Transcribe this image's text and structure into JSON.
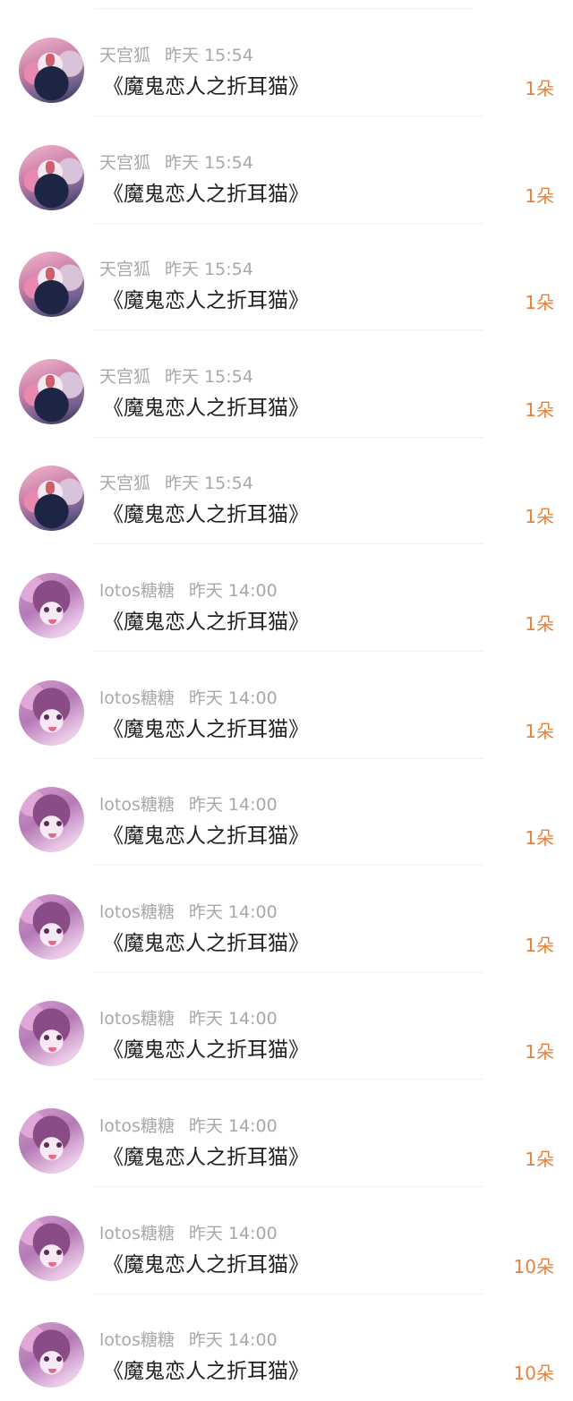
{
  "items": [
    {
      "user": "天宫狐",
      "time": "昨天 15:54",
      "title": "《魔鬼恋人之折耳猫》",
      "count": "1朵",
      "avatar": "fox-avatar"
    },
    {
      "user": "天宫狐",
      "time": "昨天 15:54",
      "title": "《魔鬼恋人之折耳猫》",
      "count": "1朵",
      "avatar": "fox-avatar"
    },
    {
      "user": "天宫狐",
      "time": "昨天 15:54",
      "title": "《魔鬼恋人之折耳猫》",
      "count": "1朵",
      "avatar": "fox-avatar"
    },
    {
      "user": "天宫狐",
      "time": "昨天 15:54",
      "title": "《魔鬼恋人之折耳猫》",
      "count": "1朵",
      "avatar": "fox-avatar"
    },
    {
      "user": "天宫狐",
      "time": "昨天 15:54",
      "title": "《魔鬼恋人之折耳猫》",
      "count": "1朵",
      "avatar": "fox-avatar"
    },
    {
      "user": "lotos糖糖",
      "time": "昨天 14:00",
      "title": "《魔鬼恋人之折耳猫》",
      "count": "1朵",
      "avatar": "girl-avatar"
    },
    {
      "user": "lotos糖糖",
      "time": "昨天 14:00",
      "title": "《魔鬼恋人之折耳猫》",
      "count": "1朵",
      "avatar": "girl-avatar"
    },
    {
      "user": "lotos糖糖",
      "time": "昨天 14:00",
      "title": "《魔鬼恋人之折耳猫》",
      "count": "1朵",
      "avatar": "girl-avatar"
    },
    {
      "user": "lotos糖糖",
      "time": "昨天 14:00",
      "title": "《魔鬼恋人之折耳猫》",
      "count": "1朵",
      "avatar": "girl-avatar"
    },
    {
      "user": "lotos糖糖",
      "time": "昨天 14:00",
      "title": "《魔鬼恋人之折耳猫》",
      "count": "1朵",
      "avatar": "girl-avatar"
    },
    {
      "user": "lotos糖糖",
      "time": "昨天 14:00",
      "title": "《魔鬼恋人之折耳猫》",
      "count": "1朵",
      "avatar": "girl-avatar"
    },
    {
      "user": "lotos糖糖",
      "time": "昨天 14:00",
      "title": "《魔鬼恋人之折耳猫》",
      "count": "10朵",
      "avatar": "girl-avatar"
    },
    {
      "user": "lotos糖糖",
      "time": "昨天 14:00",
      "title": "《魔鬼恋人之折耳猫》",
      "count": "10朵",
      "avatar": "girl-avatar"
    }
  ],
  "colors": {
    "count": "#e8803a",
    "meta": "#a8a8a8",
    "title": "#222222",
    "divider": "#f0f0f0"
  }
}
